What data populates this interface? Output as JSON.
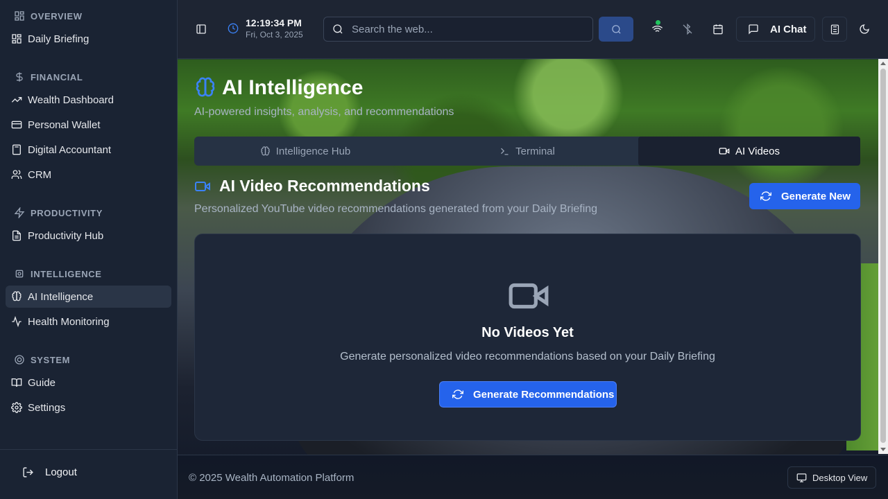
{
  "sidebar": {
    "sections": [
      {
        "label": "OVERVIEW",
        "icon": "grid-icon",
        "items": [
          {
            "label": "Daily Briefing",
            "icon": "dashboard-icon"
          }
        ]
      },
      {
        "label": "FINANCIAL",
        "icon": "dollar-icon",
        "items": [
          {
            "label": "Wealth Dashboard",
            "icon": "trending-up-icon"
          },
          {
            "label": "Personal Wallet",
            "icon": "wallet-icon"
          },
          {
            "label": "Digital Accountant",
            "icon": "calculator-icon"
          },
          {
            "label": "CRM",
            "icon": "users-icon"
          }
        ]
      },
      {
        "label": "PRODUCTIVITY",
        "icon": "zap-icon",
        "items": [
          {
            "label": "Productivity Hub",
            "icon": "document-icon"
          }
        ]
      },
      {
        "label": "INTELLIGENCE",
        "icon": "cpu-icon",
        "items": [
          {
            "label": "AI Intelligence",
            "icon": "brain-icon",
            "active": true
          },
          {
            "label": "Health Monitoring",
            "icon": "activity-icon"
          }
        ]
      },
      {
        "label": "SYSTEM",
        "icon": "lifebuoy-icon",
        "items": [
          {
            "label": "Guide",
            "icon": "book-icon"
          },
          {
            "label": "Settings",
            "icon": "gear-icon"
          }
        ]
      }
    ],
    "logout_label": "Logout"
  },
  "topbar": {
    "time": "12:19:34 PM",
    "date": "Fri, Oct 3, 2025",
    "search_placeholder": "Search the web...",
    "ai_chat_label": "AI Chat"
  },
  "main": {
    "title": "AI Intelligence",
    "subtitle": "AI-powered insights, analysis, and recommendations",
    "tabs": [
      {
        "label": "Intelligence Hub"
      },
      {
        "label": "Terminal"
      },
      {
        "label": "AI Videos",
        "active": true
      }
    ],
    "section_title": "AI Video Recommendations",
    "section_subtitle": "Personalized YouTube video recommendations generated from your Daily Briefing",
    "generate_new_label": "Generate New",
    "empty_title": "No Videos Yet",
    "empty_subtitle": "Generate personalized video recommendations based on your Daily Briefing",
    "generate_rec_label": "Generate Recommendations"
  },
  "footer": {
    "copyright": "© 2025 Wealth Automation Platform",
    "view_label": "Desktop View"
  },
  "colors": {
    "accent": "#2563eb",
    "sidebar_bg": "#1a2333",
    "online": "#22c55e"
  }
}
